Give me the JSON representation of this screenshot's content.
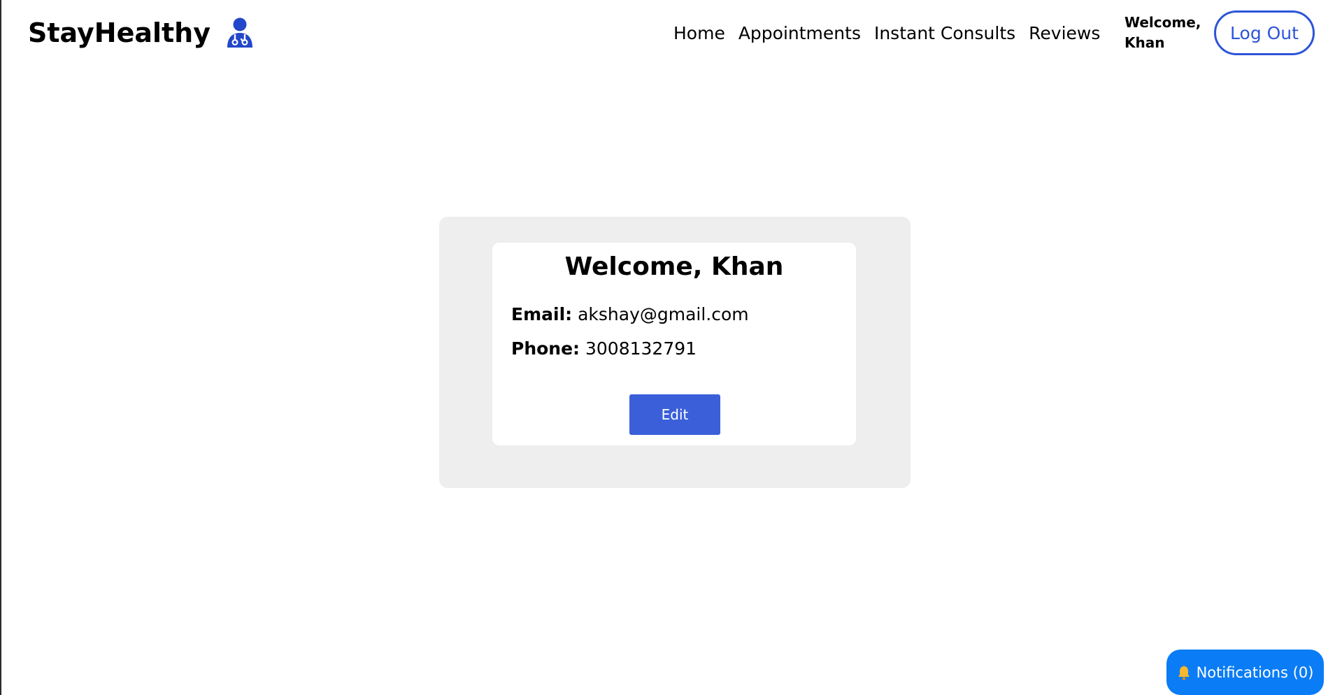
{
  "navbar": {
    "brand": "StayHealthy",
    "links": [
      "Home",
      "Appointments",
      "Instant Consults",
      "Reviews"
    ],
    "welcome": "Welcome,\nKhan",
    "logout_label": "Log Out"
  },
  "colors": {
    "accent": "#2d55d8",
    "edit_button": "#3a5fd9",
    "notification": "#0a7cf5",
    "panel": "#eeeeee"
  },
  "icons": {
    "brand_logo": "doctor-icon",
    "notification": "bell-icon"
  },
  "profile": {
    "title": "Welcome, Khan",
    "email_label": "Email:",
    "email": "akshay@gmail.com",
    "phone_label": "Phone:",
    "phone": "3008132791",
    "edit_label": "Edit"
  },
  "notifications": {
    "label": "Notifications (0)"
  }
}
